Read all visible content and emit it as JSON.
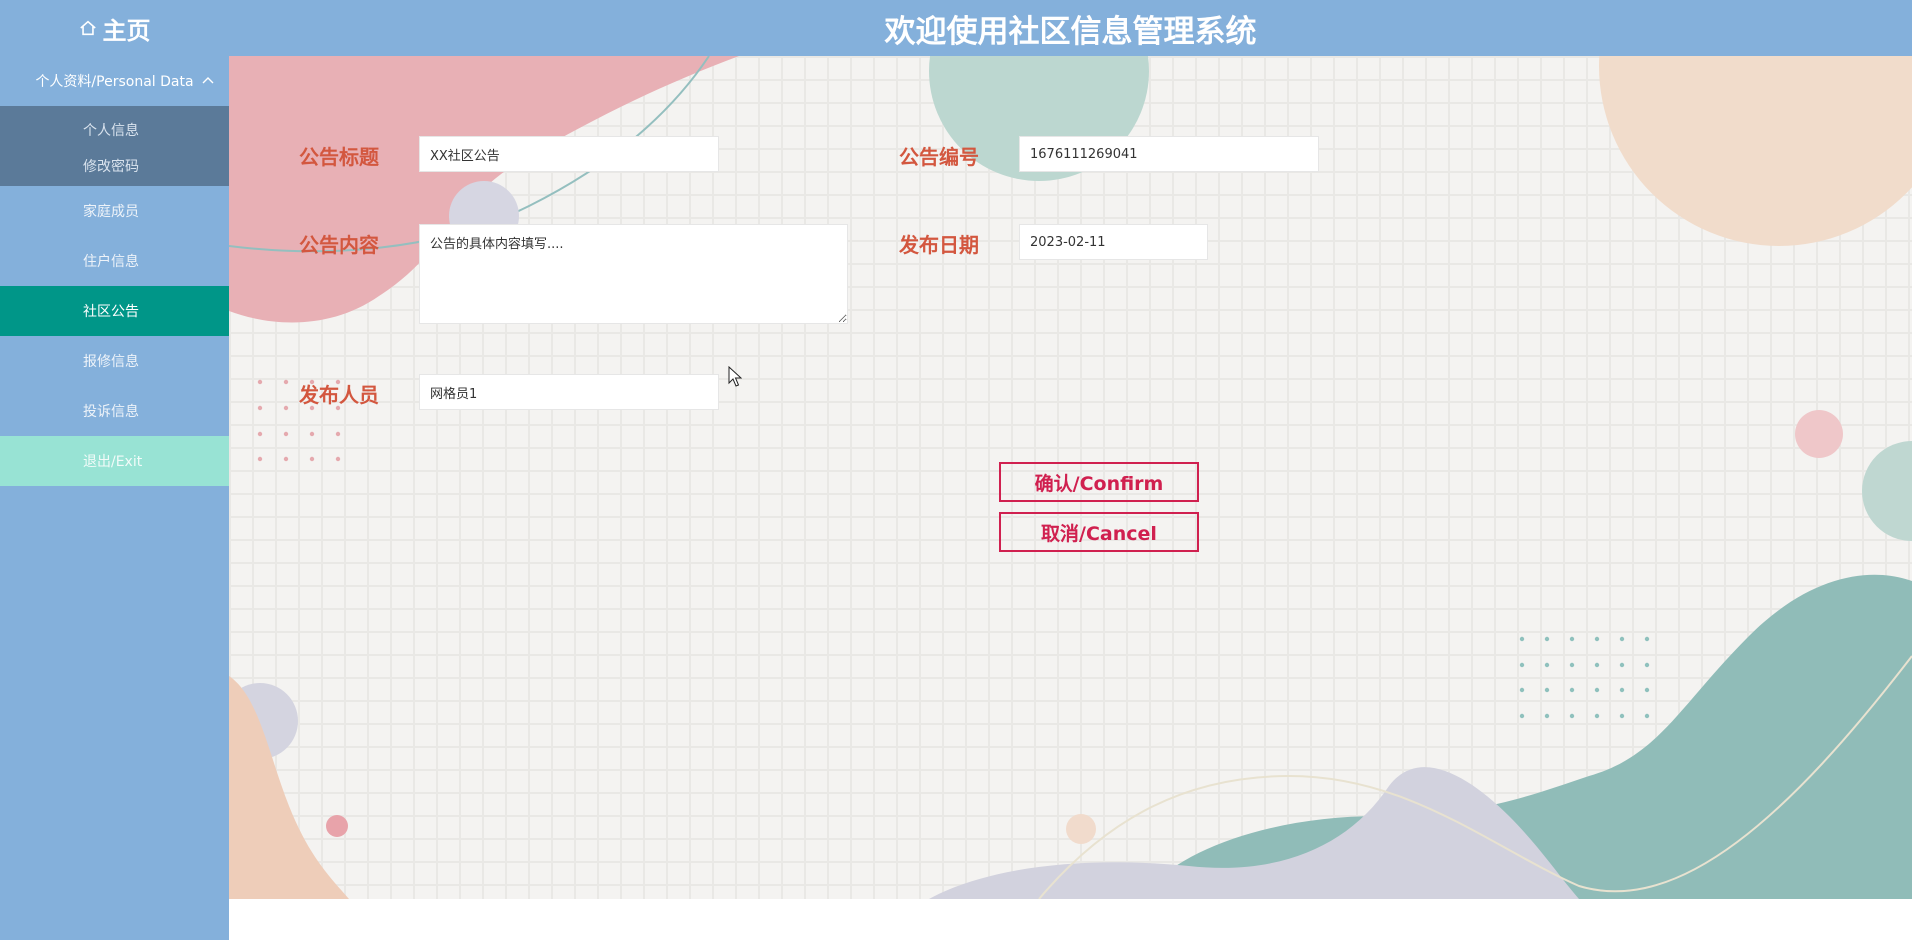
{
  "header": {
    "home_label": "主页",
    "title": "欢迎使用社区信息管理系统"
  },
  "sidebar": {
    "group_label": "个人资料/Personal Data",
    "sub_items": [
      {
        "label": "个人信息"
      },
      {
        "label": "修改密码"
      }
    ],
    "items": [
      {
        "label": "家庭成员"
      },
      {
        "label": "住户信息"
      },
      {
        "label": "社区公告",
        "active": true
      },
      {
        "label": "报修信息"
      },
      {
        "label": "投诉信息"
      },
      {
        "label": "退出/Exit"
      }
    ]
  },
  "form": {
    "title_label": "公告标题",
    "title_value": "XX社区公告",
    "number_label": "公告编号",
    "number_value": "1676111269041",
    "content_label": "公告内容",
    "content_value": "公告的具体内容填写....",
    "date_label": "发布日期",
    "date_value": "2023-02-11",
    "publisher_label": "发布人员",
    "publisher_value": "网格员1",
    "confirm_label": "确认/Confirm",
    "cancel_label": "取消/Cancel"
  },
  "colors": {
    "header_bg": "#84b0db",
    "active_menu": "#009688",
    "label": "#d3573f",
    "button": "#d0204f"
  },
  "icons": {
    "home": "home-icon",
    "chevron": "chevron-up-icon"
  }
}
